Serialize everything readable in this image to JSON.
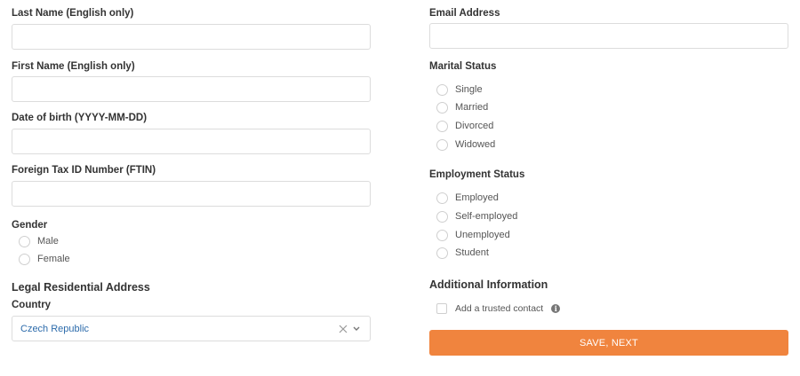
{
  "left": {
    "last_name": {
      "label": "Last Name (English only)",
      "value": ""
    },
    "first_name": {
      "label": "First Name (English only)",
      "value": ""
    },
    "dob": {
      "label": "Date of birth (YYYY-MM-DD)",
      "value": ""
    },
    "ftin": {
      "label": "Foreign Tax ID Number (FTIN)",
      "value": ""
    },
    "gender": {
      "label": "Gender",
      "options": [
        "Male",
        "Female"
      ]
    },
    "address": {
      "heading": "Legal Residential Address",
      "country_label": "Country",
      "country_value": "Czech Republic"
    }
  },
  "right": {
    "email": {
      "label": "Email Address",
      "value": ""
    },
    "marital": {
      "label": "Marital Status",
      "options": [
        "Single",
        "Married",
        "Divorced",
        "Widowed"
      ]
    },
    "employment": {
      "label": "Employment Status",
      "options": [
        "Employed",
        "Self-employed",
        "Unemployed",
        "Student"
      ]
    },
    "additional": {
      "heading": "Additional Information",
      "trusted_contact": "Add a trusted contact"
    },
    "submit_label": "SAVE, NEXT"
  },
  "colors": {
    "accent": "#f0843e",
    "select_text": "#2c6bab",
    "border": "#dcdcdc"
  },
  "icons": {
    "clear": "close-icon",
    "dropdown": "chevron-down-icon",
    "info": "info-icon"
  }
}
